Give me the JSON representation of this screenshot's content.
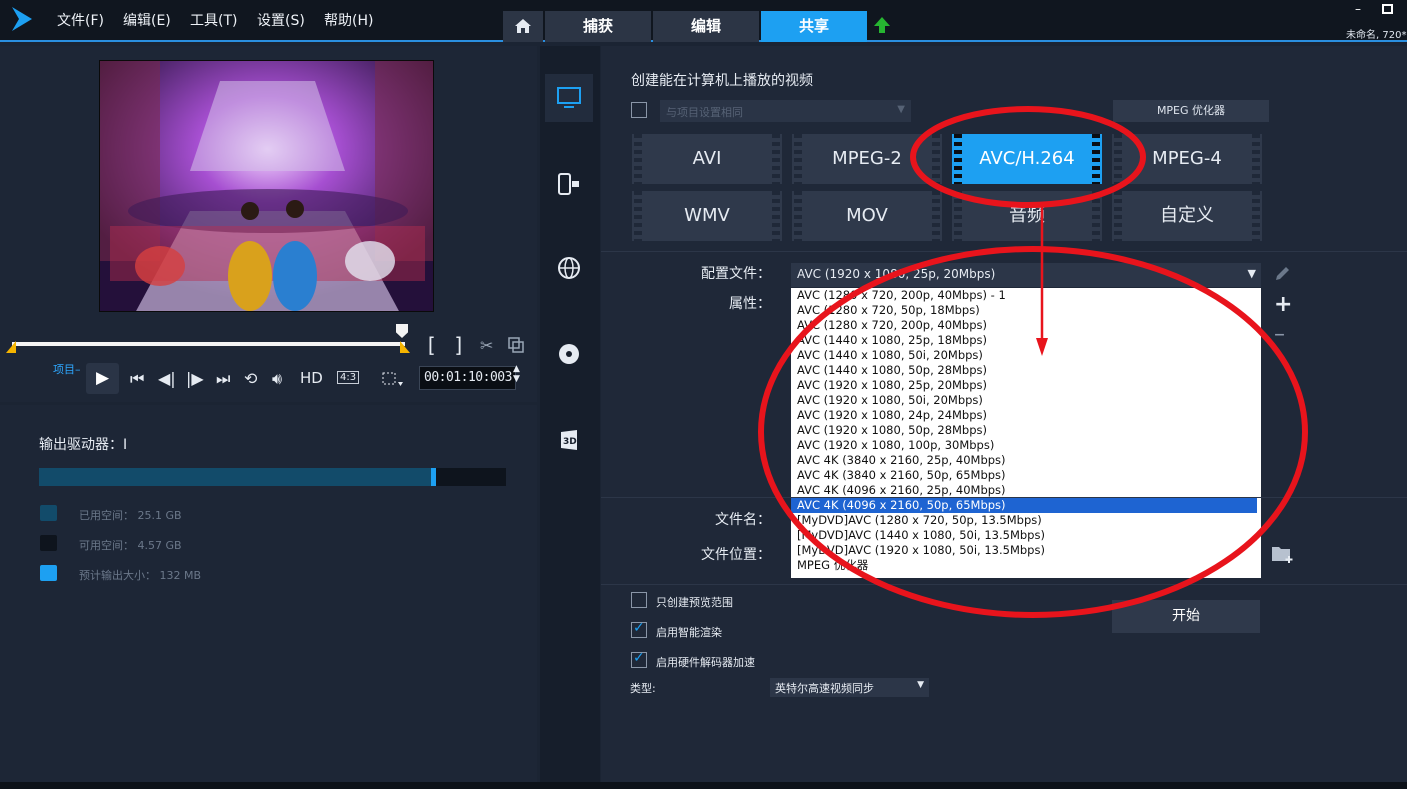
{
  "menu": [
    "文件(F)",
    "编辑(E)",
    "工具(T)",
    "设置(S)",
    "帮助(H)"
  ],
  "tabs": [
    "捕获",
    "编辑",
    "共享"
  ],
  "window": {
    "minimize": "–",
    "title_partial": "未命名, 720*"
  },
  "player": {
    "project_label": "项目–",
    "hd": "HD",
    "aspect": "4:3",
    "timecode": "00:01:10:003"
  },
  "storage": {
    "drive_label": "输出驱动器：I",
    "used_fraction": 0.84,
    "legend": [
      {
        "label": "已用空间：",
        "value": "25.1 GB",
        "color": "#124b6a"
      },
      {
        "label": "可用空间：",
        "value": "4.57 GB",
        "color": "#0e141d"
      },
      {
        "label": "预计输出大小：",
        "value": "132 MB",
        "color": "#1da0f2"
      }
    ]
  },
  "share": {
    "header": "创建能在计算机上播放的视频",
    "project_select_placeholder": "与项目设置相同",
    "mpeg_optimizer": "MPEG 优化器",
    "formats": [
      "AVI",
      "MPEG-2",
      "AVC/H.264",
      "MPEG-4",
      "WMV",
      "MOV",
      "音频",
      "自定义"
    ],
    "active_format": "AVC/H.264",
    "profile_label": "配置文件：",
    "properties_label": "属性：",
    "profile_selected": "AVC (1920 x 1080, 25p, 20Mbps)",
    "profile_options": [
      "AVC (1280 x 720, 200p, 40Mbps) - 1",
      "AVC (1280 x 720, 50p, 18Mbps)",
      "AVC (1280 x 720, 200p, 40Mbps)",
      "AVC (1440 x 1080, 25p, 18Mbps)",
      "AVC (1440 x 1080, 50i, 20Mbps)",
      "AVC (1440 x 1080, 50p, 28Mbps)",
      "AVC (1920 x 1080, 25p, 20Mbps)",
      "AVC (1920 x 1080, 50i, 20Mbps)",
      "AVC (1920 x 1080, 24p, 24Mbps)",
      "AVC (1920 x 1080, 50p, 28Mbps)",
      "AVC (1920 x 1080, 100p, 30Mbps)",
      "AVC 4K (3840 x 2160, 25p, 40Mbps)",
      "AVC 4K (3840 x 2160, 50p, 65Mbps)",
      "AVC 4K (4096 x 2160, 25p, 40Mbps)",
      "AVC 4K (4096 x 2160, 50p, 65Mbps)",
      "[MyDVD]AVC (1280 x 720, 50p, 13.5Mbps)",
      "[MyDVD]AVC (1440 x 1080, 50i, 13.5Mbps)",
      "[MyDVD]AVC (1920 x 1080, 50i, 13.5Mbps)",
      "MPEG 优化器"
    ],
    "highlighted_option": "AVC 4K (4096 x 2160, 50p, 65Mbps)",
    "filename_label": "文件名：",
    "location_label": "文件位置：",
    "options": [
      {
        "label": "只创建预览范围",
        "checked": false
      },
      {
        "label": "启用智能渲染",
        "checked": true
      },
      {
        "label": "启用硬件解码器加速",
        "checked": true
      }
    ],
    "type_label": "类型:",
    "type_value": "英特尔高速视频同步",
    "start_button": "开始"
  },
  "colors": {
    "accent": "#1da0f2",
    "annotation": "#e8141c"
  }
}
